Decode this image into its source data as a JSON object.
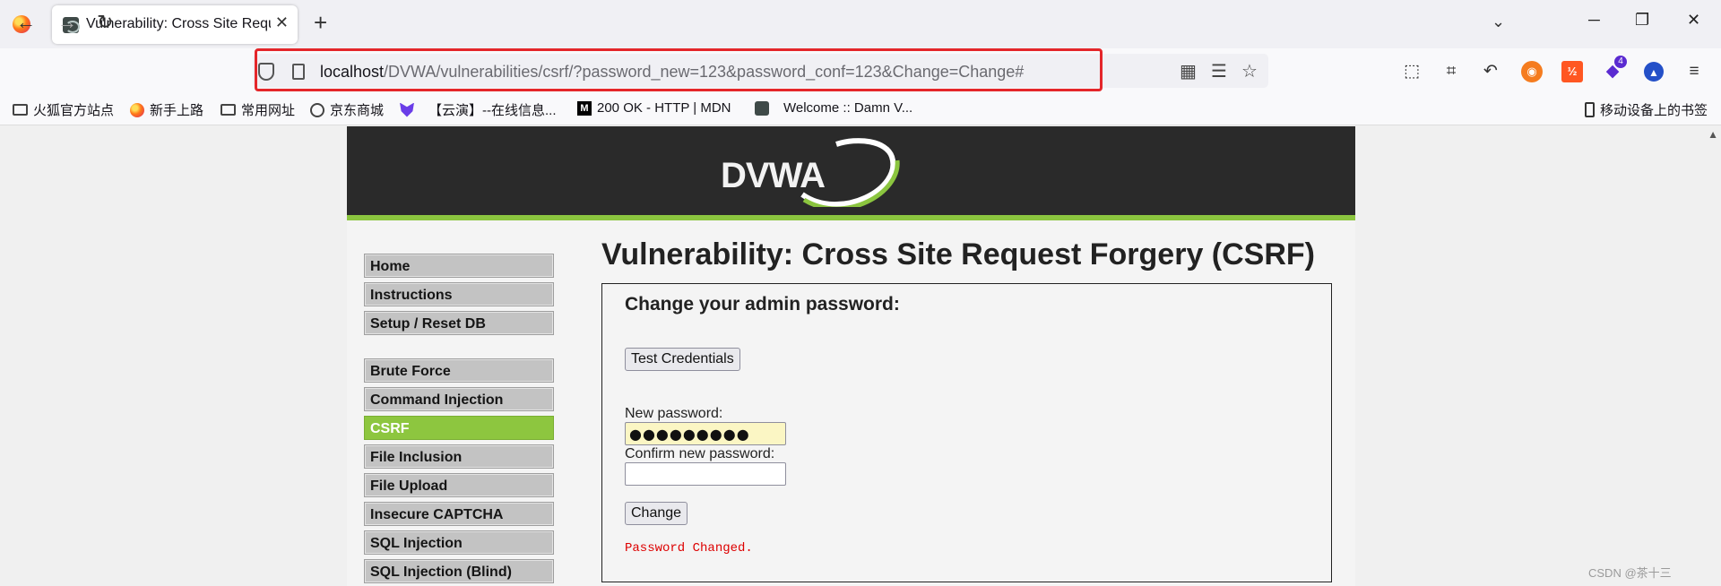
{
  "browser": {
    "tab_title": "Vulnerability: Cross Site Request Forgery (CSRF) :: Damn Vulnerable Web Application (DVWA)",
    "url_host": "localhost",
    "url_path": "/DVWA/vulnerabilities/csrf/?password_new=123&password_conf=123&Change=Change#",
    "highlight_color": "#e4262a",
    "icons": {
      "back": "←",
      "forward": "→",
      "reload": "↻",
      "newtab": "+",
      "tablist": "⌄",
      "minimize": "─",
      "restore": "❐",
      "close": "✕",
      "tab_close": "✕",
      "qr": "▦",
      "reader": "☰",
      "bookmark_star": "☆",
      "extensions": "⬚",
      "crop": "⌗",
      "undo": "↶",
      "fox": "◉",
      "orange_ext": "½",
      "purple_ext": "◆",
      "purple_badge": "4",
      "blue_ext": "▲",
      "menu": "≡"
    }
  },
  "bookmarks": {
    "items": [
      {
        "label": "火狐官方站点"
      },
      {
        "label": "新手上路"
      },
      {
        "label": "常用网址"
      },
      {
        "label": "京东商城"
      },
      {
        "label": "【云演】--在线信息..."
      },
      {
        "label": "200 OK - HTTP | MDN"
      },
      {
        "label": "Welcome :: Damn V..."
      }
    ],
    "mobile": "移动设备上的书签",
    "mdn_glyph": "M"
  },
  "dvwa": {
    "logo_text": "DVWA",
    "accent_color": "#8dc63f",
    "menu": [
      {
        "label": "Home"
      },
      {
        "label": "Instructions"
      },
      {
        "label": "Setup / Reset DB"
      },
      {
        "label": "Brute Force"
      },
      {
        "label": "Command Injection"
      },
      {
        "label": "CSRF"
      },
      {
        "label": "File Inclusion"
      },
      {
        "label": "File Upload"
      },
      {
        "label": "Insecure CAPTCHA"
      },
      {
        "label": "SQL Injection"
      },
      {
        "label": "SQL Injection (Blind)"
      }
    ],
    "active_menu": "CSRF",
    "title": "Vulnerability: Cross Site Request Forgery (CSRF)",
    "form": {
      "heading": "Change your admin password:",
      "test_button": "Test Credentials",
      "new_password_label": "New password:",
      "new_password_value": "●●●●●●●●●",
      "confirm_label": "Confirm new password:",
      "confirm_value": "",
      "change_button": "Change",
      "result": "Password Changed."
    }
  },
  "watermark": "CSDN @茶十三"
}
